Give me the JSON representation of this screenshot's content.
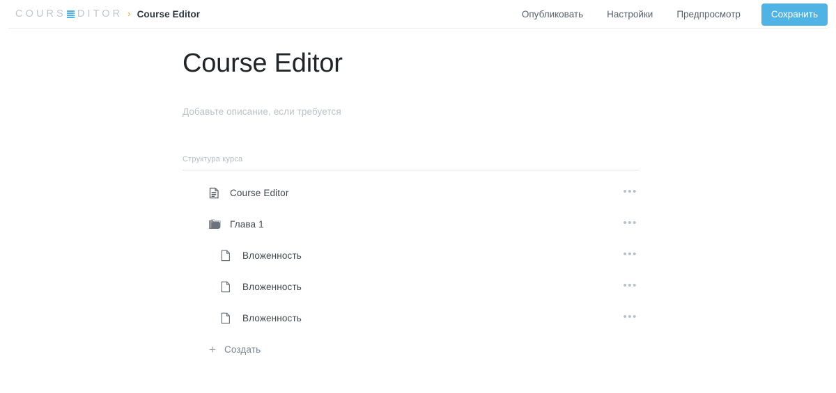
{
  "header": {
    "logo": {
      "text_before": "COURS",
      "accent_letter": "E",
      "text_after": "DITOR",
      "accent_color": "#4eb4e8"
    },
    "breadcrumb_separator": "›",
    "breadcrumb_current": "Course Editor",
    "nav": [
      {
        "label": "Опубликовать",
        "name": "nav-publish"
      },
      {
        "label": "Настройки",
        "name": "nav-settings"
      },
      {
        "label": "Предпросмотр",
        "name": "nav-preview"
      }
    ],
    "save_label": "Сохранить",
    "save_color": "#4fb3e6"
  },
  "main": {
    "title": "Course Editor",
    "description_placeholder": "Добавьте описание, если требуется",
    "description_value": "",
    "structure_label": "Структура курса",
    "tree": [
      {
        "label": "Course Editor",
        "icon": "article-icon",
        "indent": false,
        "menu": "•••"
      },
      {
        "label": "Глава 1",
        "icon": "folder-icon",
        "indent": false,
        "menu": "•••"
      },
      {
        "label": "Вложенность",
        "icon": "page-icon",
        "indent": true,
        "menu": "•••"
      },
      {
        "label": "Вложенность",
        "icon": "page-icon",
        "indent": true,
        "menu": "•••"
      },
      {
        "label": "Вложенность",
        "icon": "page-icon",
        "indent": true,
        "menu": "•••"
      }
    ],
    "create_label": "Создать",
    "create_plus": "+"
  }
}
